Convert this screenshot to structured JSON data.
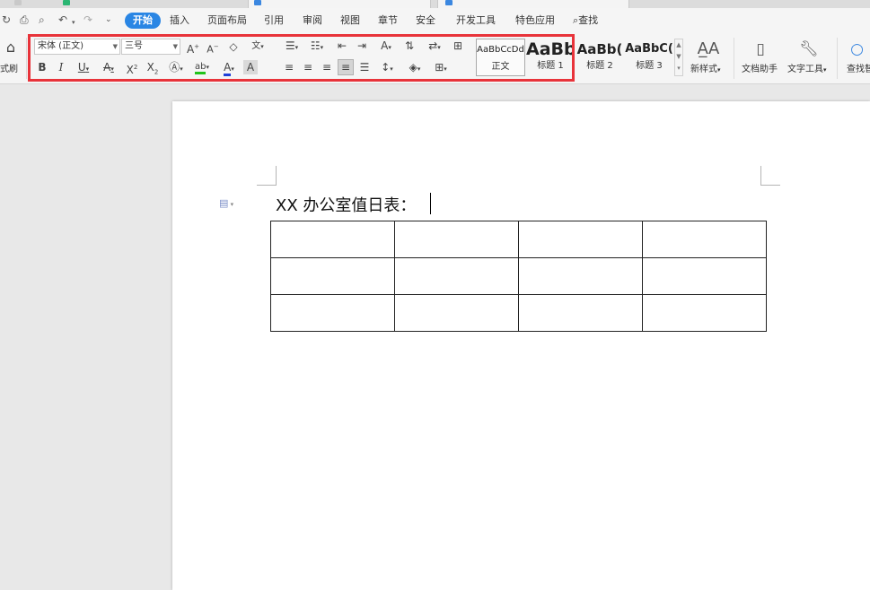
{
  "tabstrip": {
    "tab1": "",
    "tab2": ""
  },
  "quick_access": {
    "icons": [
      "redo-icon",
      "print-icon",
      "print-preview-icon",
      "undo-icon",
      "undo-dropdown-icon",
      "redo-gray-icon",
      "more-icon"
    ]
  },
  "menu": {
    "items": [
      "开始",
      "插入",
      "页面布局",
      "引用",
      "审阅",
      "视图",
      "章节",
      "安全",
      "开发工具",
      "特色应用"
    ],
    "search_label": "查找",
    "active_index": 0,
    "active_color": "#2a86e4"
  },
  "ribbon": {
    "format_painter_label": "式刷",
    "font_name": "宋体 (正文)",
    "font_size": "三号",
    "styles": [
      {
        "preview": "AaBbCcDd",
        "name": "正文"
      },
      {
        "preview": "AaBb",
        "name": "标题 1"
      },
      {
        "preview": "AaBb(",
        "name": "标题 2"
      },
      {
        "preview": "AaBbC(",
        "name": "标题 3"
      }
    ],
    "new_style_label": "新样式",
    "doc_assistant_label": "文档助手",
    "text_tools_label": "文字工具",
    "find_replace_label": "查找替",
    "highlight_color": "#e8333a"
  },
  "document": {
    "heading_text": "XX 办公室值日表：",
    "table": {
      "rows": 3,
      "cols": 4
    }
  }
}
